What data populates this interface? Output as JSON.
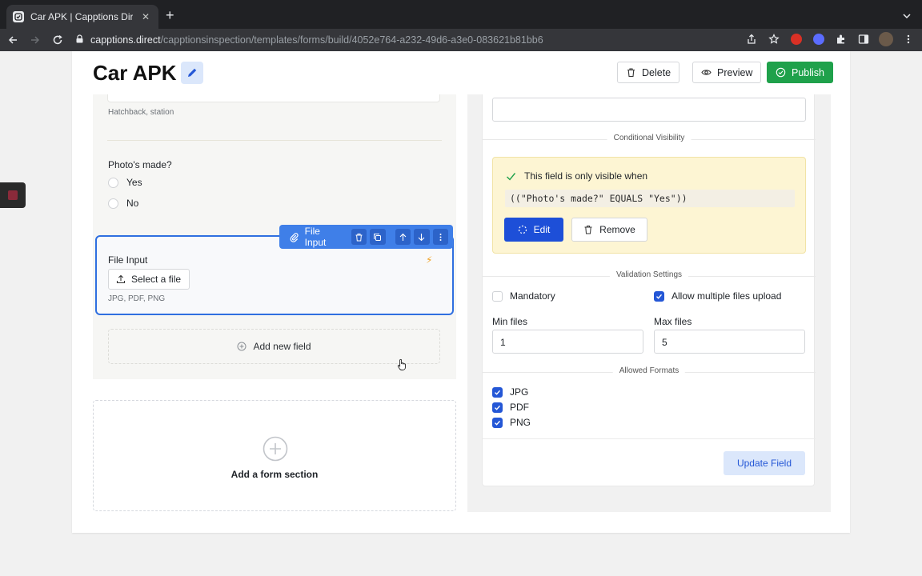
{
  "browser": {
    "tab_title": "Car APK | Capptions Direct",
    "url_host": "capptions.direct",
    "url_path": "/capptionsinspection/templates/forms/build/4052e764-a232-49d6-a3e0-083621b81bb6"
  },
  "header": {
    "title": "Car APK",
    "delete_label": "Delete",
    "preview_label": "Preview",
    "publish_label": "Publish"
  },
  "form": {
    "prev_field_hint": "Hatchback, station",
    "question_label": "Photo's made?",
    "options": [
      "Yes",
      "No"
    ],
    "toolbar_label": "File Input",
    "field_label": "File Input",
    "select_file_label": "Select a file",
    "formats_hint": "JPG, PDF, PNG",
    "add_field_label": "Add new field",
    "add_section_label": "Add a form section"
  },
  "settings": {
    "conditional_heading": "Conditional Visibility",
    "condition_title": "This field is only visible when",
    "condition_expression": "((\"Photo's made?\" EQUALS \"Yes\"))",
    "edit_label": "Edit",
    "remove_label": "Remove",
    "validation_heading": "Validation Settings",
    "mandatory_label": "Mandatory",
    "mandatory_checked": false,
    "multiple_label": "Allow multiple files upload",
    "multiple_checked": true,
    "min_label": "Min files",
    "min_value": "1",
    "max_label": "Max files",
    "max_value": "5",
    "formats_heading": "Allowed Formats",
    "formats": [
      {
        "label": "JPG",
        "checked": true
      },
      {
        "label": "PDF",
        "checked": true
      },
      {
        "label": "PNG",
        "checked": true
      }
    ],
    "update_label": "Update Field"
  },
  "colors": {
    "publish": "#1fa14b",
    "primary": "#1d4fd8",
    "selection": "#2f6fe0",
    "condition_bg": "#fdf5d3"
  }
}
